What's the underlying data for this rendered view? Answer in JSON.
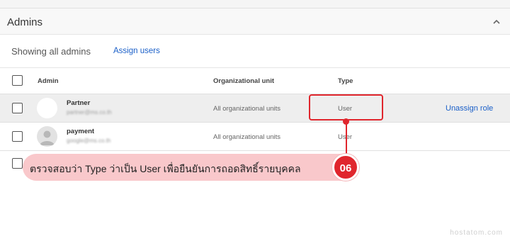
{
  "section": {
    "title": "Admins"
  },
  "toolbar": {
    "showing": "Showing all admins",
    "assign_label": "Assign users"
  },
  "table": {
    "headers": {
      "admin": "Admin",
      "org_unit": "Organizational unit",
      "type": "Type"
    },
    "rows": [
      {
        "name": "Partner",
        "email": "partner@ms.co.th",
        "org_unit": "All organizational units",
        "type": "User",
        "action": "Unassign role"
      },
      {
        "name": "payment",
        "email": "google@ms.co.th",
        "org_unit": "All organizational units",
        "type": "User"
      }
    ]
  },
  "annotation": {
    "text": "ตรวจสอบว่า Type ว่าเป็น User เพื่อยืนยันการถอดสิทธิ์รายบุคคล",
    "step": "06"
  },
  "watermark": "hostatom.com",
  "colors": {
    "link": "#1a5fc8",
    "highlight": "#e0262d",
    "callout_bg": "#f9c8cb"
  }
}
